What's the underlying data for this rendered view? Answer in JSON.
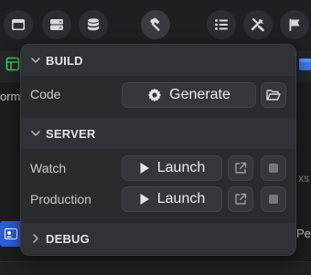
{
  "toolbar": {
    "icons": [
      "window-icon",
      "server-icon",
      "database-icon",
      "hammer-icon",
      "list-icon",
      "tools-icon",
      "flag-icon"
    ]
  },
  "background": {
    "left_fragment": "orm",
    "right_fragment_xs": "xs",
    "right_fragment_pe": "Pe"
  },
  "popover": {
    "build": {
      "title": "BUILD",
      "code_label": "Code",
      "generate_label": "Generate"
    },
    "server": {
      "title": "SERVER",
      "watch_label": "Watch",
      "production_label": "Production",
      "launch_label": "Launch"
    },
    "debug": {
      "title": "DEBUG"
    }
  },
  "colors": {
    "popover_bg": "#2a2b2f",
    "section_header_bg": "#313237",
    "button_bg": "#36373c"
  }
}
